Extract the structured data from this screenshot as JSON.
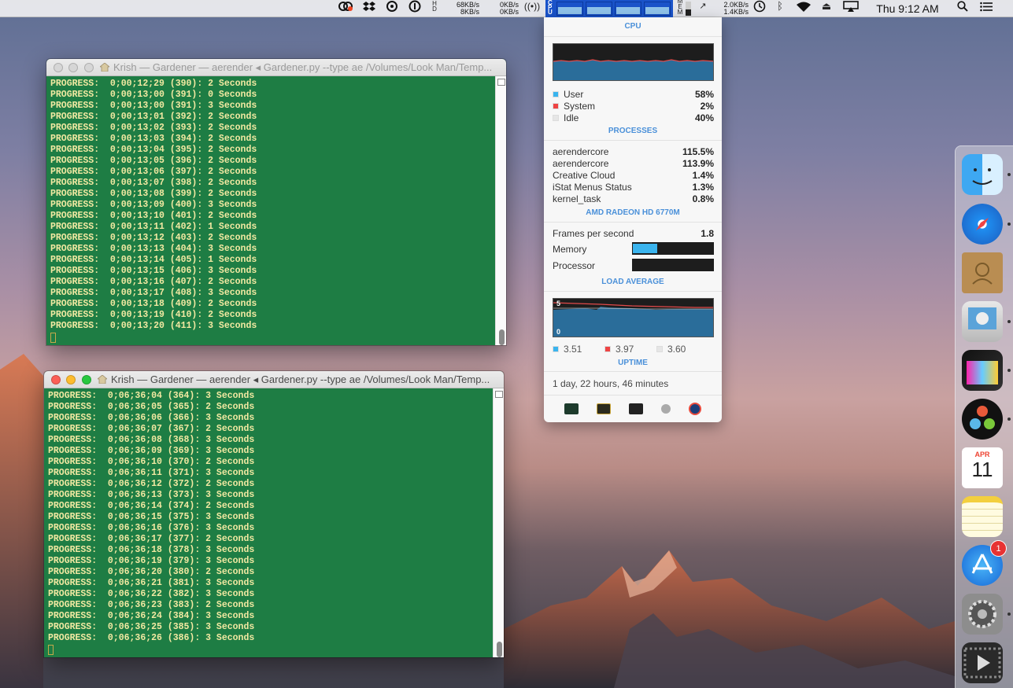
{
  "menubar": {
    "net_left": {
      "up": "68KB/s",
      "down": "8KB/s"
    },
    "net_mid": {
      "up": "0KB/s",
      "down": "0KB/s"
    },
    "net_right": {
      "up": "2.0KB/s",
      "down": "1.4KB/s"
    },
    "clock": "Thu 9:12 AM",
    "icons": [
      "creative-cloud-icon",
      "dropbox-icon",
      "sync-icon",
      "info-icon",
      "hd-icon",
      "wireless-activity-icon",
      "istat-cpu-icon",
      "memory-icon",
      "network-arrows-icon",
      "time-machine-icon",
      "bluetooth-icon",
      "wifi-icon",
      "eject-icon",
      "airplay-icon",
      "spotlight-icon",
      "notification-center-icon"
    ]
  },
  "terminal_top": {
    "title": "Krish — Gardener — aerender ◂ Gardener.py --type ae /Volumes/Look Man/Temp...",
    "lines": [
      "PROGRESS:  0;00;12;29 (390): 2 Seconds",
      "PROGRESS:  0;00;13;00 (391): 0 Seconds",
      "PROGRESS:  0;00;13;00 (391): 3 Seconds",
      "PROGRESS:  0;00;13;01 (392): 2 Seconds",
      "PROGRESS:  0;00;13;02 (393): 2 Seconds",
      "PROGRESS:  0;00;13;03 (394): 2 Seconds",
      "PROGRESS:  0;00;13;04 (395): 2 Seconds",
      "PROGRESS:  0;00;13;05 (396): 2 Seconds",
      "PROGRESS:  0;00;13;06 (397): 2 Seconds",
      "PROGRESS:  0;00;13;07 (398): 2 Seconds",
      "PROGRESS:  0;00;13;08 (399): 2 Seconds",
      "PROGRESS:  0;00;13;09 (400): 3 Seconds",
      "PROGRESS:  0;00;13;10 (401): 2 Seconds",
      "PROGRESS:  0;00;13;11 (402): 1 Seconds",
      "PROGRESS:  0;00;13;12 (403): 2 Seconds",
      "PROGRESS:  0;00;13;13 (404): 3 Seconds",
      "PROGRESS:  0;00;13;14 (405): 1 Seconds",
      "PROGRESS:  0;00;13;15 (406): 3 Seconds",
      "PROGRESS:  0;00;13;16 (407): 2 Seconds",
      "PROGRESS:  0;00;13;17 (408): 3 Seconds",
      "PROGRESS:  0;00;13;18 (409): 2 Seconds",
      "PROGRESS:  0;00;13;19 (410): 2 Seconds",
      "PROGRESS:  0;00;13;20 (411): 3 Seconds"
    ]
  },
  "terminal_bottom": {
    "title": "Krish — Gardener — aerender ◂ Gardener.py --type ae /Volumes/Look Man/Temp...",
    "lines": [
      "PROGRESS:  0;06;36;04 (364): 3 Seconds",
      "PROGRESS:  0;06;36;05 (365): 2 Seconds",
      "PROGRESS:  0;06;36;06 (366): 3 Seconds",
      "PROGRESS:  0;06;36;07 (367): 2 Seconds",
      "PROGRESS:  0;06;36;08 (368): 3 Seconds",
      "PROGRESS:  0;06;36;09 (369): 3 Seconds",
      "PROGRESS:  0;06;36;10 (370): 2 Seconds",
      "PROGRESS:  0;06;36;11 (371): 3 Seconds",
      "PROGRESS:  0;06;36;12 (372): 2 Seconds",
      "PROGRESS:  0;06;36;13 (373): 3 Seconds",
      "PROGRESS:  0;06;36;14 (374): 2 Seconds",
      "PROGRESS:  0;06;36;15 (375): 3 Seconds",
      "PROGRESS:  0;06;36;16 (376): 3 Seconds",
      "PROGRESS:  0;06;36;17 (377): 2 Seconds",
      "PROGRESS:  0;06;36;18 (378): 3 Seconds",
      "PROGRESS:  0;06;36;19 (379): 3 Seconds",
      "PROGRESS:  0;06;36;20 (380): 2 Seconds",
      "PROGRESS:  0;06;36;21 (381): 3 Seconds",
      "PROGRESS:  0;06;36;22 (382): 3 Seconds",
      "PROGRESS:  0;06;36;23 (383): 2 Seconds",
      "PROGRESS:  0;06;36;24 (384): 3 Seconds",
      "PROGRESS:  0;06;36;25 (385): 3 Seconds",
      "PROGRESS:  0;06;36;26 (386): 3 Seconds"
    ]
  },
  "istat": {
    "cpu_header": "CPU",
    "cpu_rows": [
      {
        "label": "User",
        "value": "58%",
        "color": "#3ab4ee"
      },
      {
        "label": "System",
        "value": "2%",
        "color": "#ee4444"
      },
      {
        "label": "Idle",
        "value": "40%",
        "color": "#e6e6e6"
      }
    ],
    "processes_header": "PROCESSES",
    "processes": [
      {
        "name": "aerendercore",
        "value": "115.5%"
      },
      {
        "name": "aerendercore",
        "value": "113.9%"
      },
      {
        "name": "Creative Cloud",
        "value": "1.4%"
      },
      {
        "name": "iStat Menus Status",
        "value": "1.3%"
      },
      {
        "name": "kernel_task",
        "value": "0.8%"
      }
    ],
    "gpu_header": "AMD RADEON HD 6770M",
    "fps_label": "Frames per second",
    "fps_value": "1.8",
    "memory_label": "Memory",
    "memory_fraction": 0.3,
    "processor_label": "Processor",
    "processor_fraction": 0.0,
    "load_header": "LOAD AVERAGE",
    "load_axis_max": "5",
    "load_axis_min": "0",
    "load_values": [
      {
        "value": "3.51",
        "color": "#3ab4ee"
      },
      {
        "value": "3.97",
        "color": "#ee4444"
      },
      {
        "value": "3.60",
        "color": "#e6e6e6"
      }
    ],
    "uptime_header": "UPTIME",
    "uptime": "1 day, 22 hours, 46 minutes",
    "footer_icons": [
      "activity-monitor-icon",
      "console-icon",
      "terminal-icon",
      "system-info-icon",
      "disk-utility-icon"
    ]
  },
  "dock": {
    "items": [
      "finder-icon",
      "safari-icon",
      "contacts-icon",
      "preview-icon",
      "final-cut-pro-icon",
      "davinci-resolve-icon",
      "calendar-icon",
      "notes-icon",
      "app-store-icon",
      "system-preferences-icon",
      "video-player-icon"
    ],
    "calendar_month": "APR",
    "calendar_day": "11",
    "app_store_badge": "1"
  }
}
